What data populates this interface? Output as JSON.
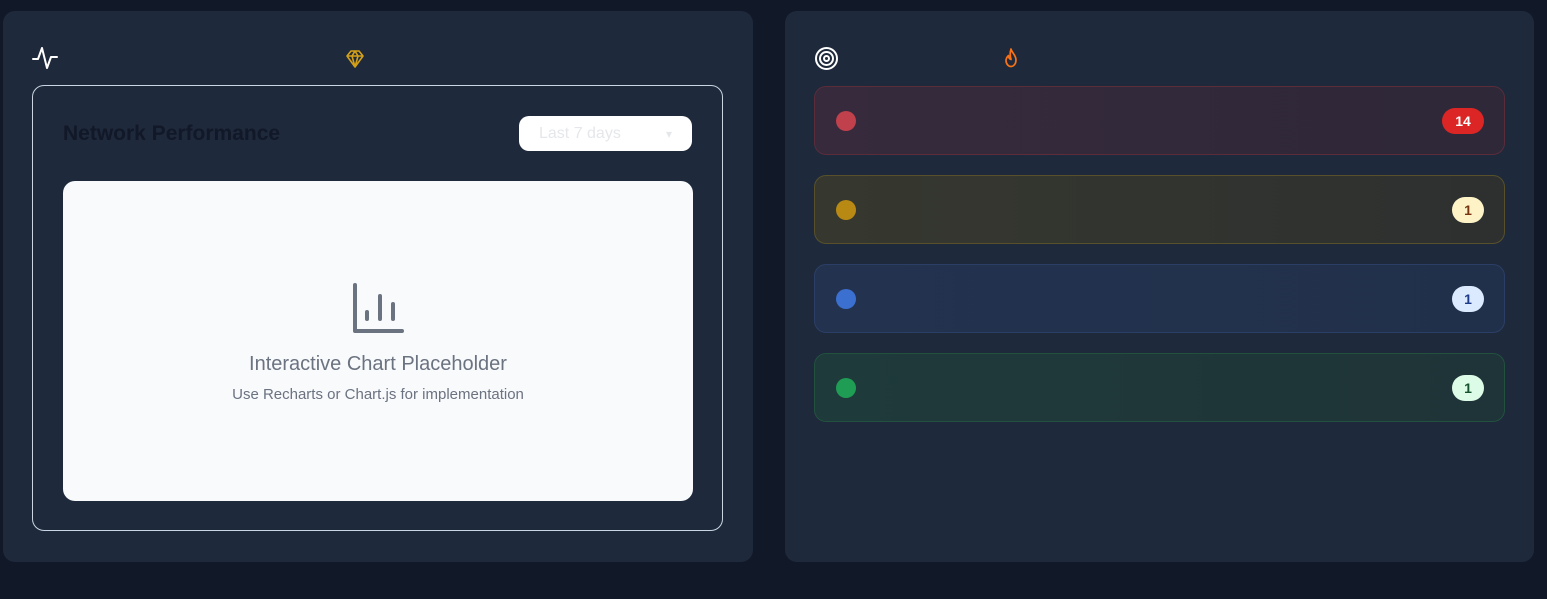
{
  "performance_panel": {
    "header_icon": "activity-icon",
    "premium_icon": "gem-icon",
    "chart_card": {
      "title": "Network Performance",
      "range_select": {
        "selected": "Last 7 days",
        "chevron_icon": "chevron-down-icon"
      },
      "placeholder": {
        "icon": "bar-chart-icon",
        "title": "Interactive Chart Placeholder",
        "subtitle": "Use Recharts or Chart.js for implementation"
      }
    }
  },
  "alerts_panel": {
    "header_icon": "target-icon",
    "hot_icon": "flame-icon",
    "rows": [
      {
        "severity": "critical",
        "color": "#dc2626",
        "count": "14"
      },
      {
        "severity": "warning",
        "color": "#b88a14",
        "count": "1"
      },
      {
        "severity": "info",
        "color": "#3b6fd0",
        "count": "1"
      },
      {
        "severity": "success",
        "color": "#1f9d55",
        "count": "1"
      }
    ]
  }
}
